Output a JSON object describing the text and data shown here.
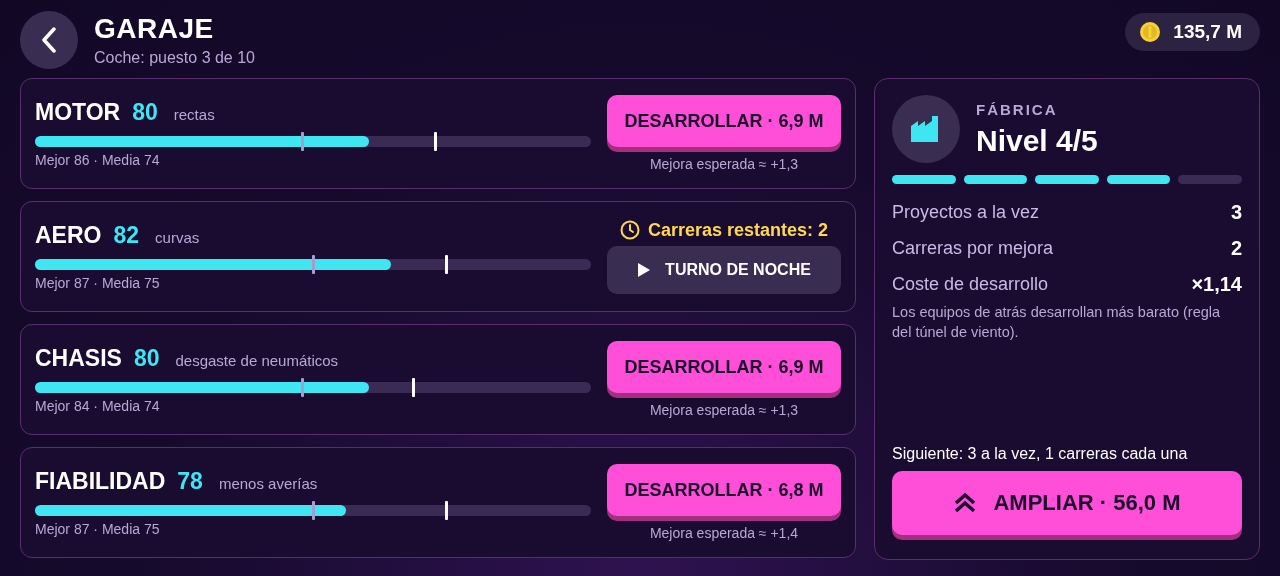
{
  "header": {
    "title": "GARAJE",
    "subtitle": "Coche: puesto 3 de 10",
    "balance": "135,7 M"
  },
  "components": [
    {
      "kind": "develop",
      "name": "MOTOR",
      "rating": "80",
      "focus": "rectas",
      "stats": "Mejor 86 · Media 74",
      "level": 0.6,
      "average_marker": {
        "level": 0.48
      },
      "best_marker": {
        "level": 0.72
      },
      "button": "DESARROLLAR · 6,9 M",
      "note": "Mejora esperada ≈ +1,3"
    },
    {
      "kind": "in_progress",
      "name": "AERO",
      "rating": "82",
      "focus": "curvas",
      "stats": "Mejor 87 · Media 75",
      "level": 0.64,
      "average_marker": {
        "level": 0.5
      },
      "best_marker": {
        "level": 0.74
      },
      "status": "Carreras restantes: 2",
      "button": "TURNO DE NOCHE"
    },
    {
      "kind": "develop",
      "name": "CHASIS",
      "rating": "80",
      "focus": "desgaste de neumáticos",
      "stats": "Mejor 84 · Media 74",
      "level": 0.6,
      "average_marker": {
        "level": 0.48
      },
      "best_marker": {
        "level": 0.68
      },
      "button": "DESARROLLAR · 6,9 M",
      "note": "Mejora esperada ≈ +1,3"
    },
    {
      "kind": "develop",
      "name": "FIABILIDAD",
      "rating": "78",
      "focus": "menos averías",
      "stats": "Mejor 87 · Media 75",
      "level": 0.56,
      "average_marker": {
        "level": 0.5
      },
      "best_marker": {
        "level": 0.74
      },
      "button": "DESARROLLAR · 6,8 M",
      "note": "Mejora esperada ≈ +1,4"
    }
  ],
  "factory": {
    "label": "FÁBRICA",
    "level_text": "Nivel 4/5",
    "segments": [
      {
        "filled": true
      },
      {
        "filled": true
      },
      {
        "filled": true
      },
      {
        "filled": true
      },
      {
        "filled": false
      }
    ],
    "stats": [
      {
        "label": "Proyectos a la vez",
        "value": "3"
      },
      {
        "label": "Carreras por mejora",
        "value": "2"
      },
      {
        "label": "Coste de desarrollo",
        "value": "×1,14"
      }
    ],
    "note": "Los equipos de atrás desarrollan más barato (regla del túnel de viento).",
    "next": "Siguiente: 3 a la vez, 1 carreras cada una",
    "button": "AMPLIAR · 56,0 M"
  }
}
